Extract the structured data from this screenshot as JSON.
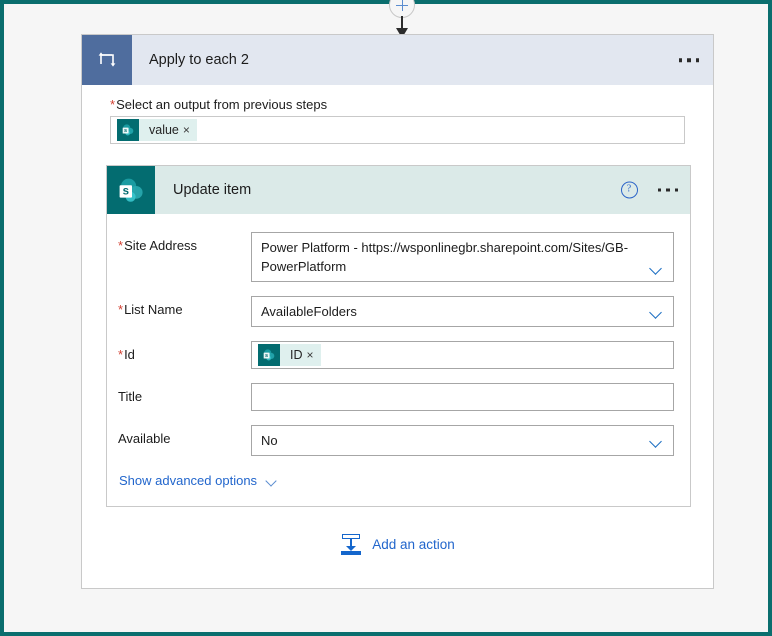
{
  "connector": {
    "add_step_label": "+",
    "arrow_name": "flow-arrow"
  },
  "loop": {
    "title": "Apply to each 2",
    "icon": "loop-icon",
    "menu": "more-commands",
    "output_field": {
      "label": "Select an output from previous steps",
      "required": true,
      "token": {
        "text": "value",
        "remove": "×",
        "icon": "sharepoint-icon"
      }
    }
  },
  "action": {
    "title": "Update item",
    "icon": "sharepoint-icon",
    "help": "?",
    "menu": "more-commands",
    "fields": [
      {
        "label": "Site Address",
        "required": true,
        "value": "Power Platform - https://wsponlinegbr.sharepoint.com/Sites/GB-PowerPlatform",
        "type": "dropdown"
      },
      {
        "label": "List Name",
        "required": true,
        "value": "AvailableFolders",
        "type": "dropdown"
      },
      {
        "label": "Id",
        "required": true,
        "value": "",
        "type": "token",
        "token": {
          "text": "ID",
          "remove": "×",
          "icon": "sharepoint-icon"
        }
      },
      {
        "label": "Title",
        "required": false,
        "value": "",
        "type": "text"
      },
      {
        "label": "Available",
        "required": false,
        "value": "No",
        "type": "dropdown"
      }
    ],
    "advanced_label": "Show advanced options"
  },
  "footer": {
    "add_action_label": "Add an action",
    "add_action_icon": "add-action-icon"
  },
  "colors": {
    "page_border": "#0a6e6e",
    "loop_header": "#e2e7f0",
    "loop_icon": "#4f6d9e",
    "sharepoint_teal": "#036c70",
    "action_header": "#dbeae8",
    "link_blue": "#2266cc",
    "required_red": "#d23f31"
  }
}
